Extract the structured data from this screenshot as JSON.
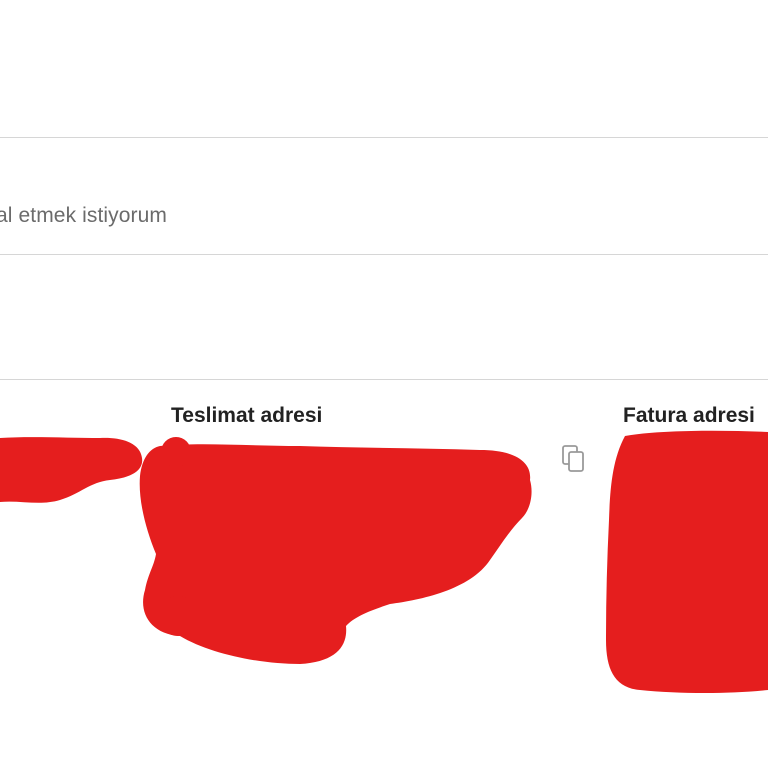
{
  "option": {
    "label": "al etmek istiyorum"
  },
  "addresses": {
    "delivery_title": "Teslimat adresi",
    "billing_title": "Fatura adresi"
  },
  "colors": {
    "redaction": "#e51e1e",
    "divider": "#d6d6d6",
    "muted_text": "#6b6b6b",
    "heading_text": "#222222"
  },
  "icons": {
    "copy": "copy-icon"
  }
}
